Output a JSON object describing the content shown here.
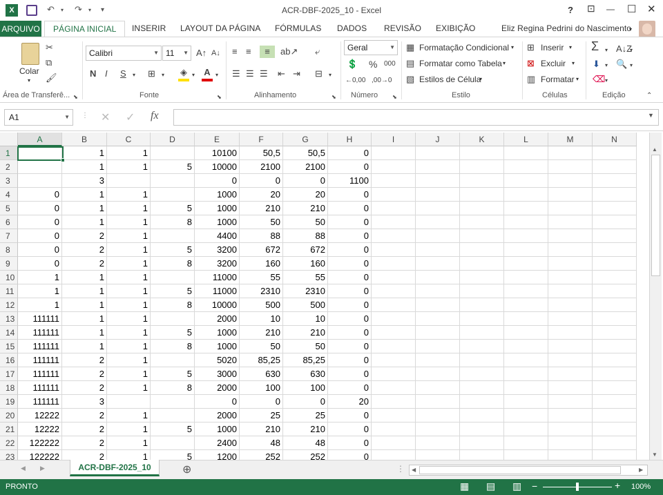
{
  "window": {
    "title": "ACR-DBF-2025_10 - Excel",
    "help_glyph": "?",
    "restore_ribbon_glyph": "⊡",
    "minimize_glyph": "—",
    "maximize_glyph": "☐",
    "close_glyph": "✕"
  },
  "quick_access": {
    "undo_glyph": "↶",
    "redo_glyph": "↷",
    "customize_glyph": "⩡"
  },
  "tabs": {
    "file": "ARQUIVO",
    "items": [
      "PÁGINA INICIAL",
      "INSERIR",
      "LAYOUT DA PÁGINA",
      "FÓRMULAS",
      "DADOS",
      "REVISÃO",
      "EXIBIÇÃO"
    ],
    "active": "PÁGINA INICIAL",
    "user": "Eliz Regina Pedrini do Nascimento"
  },
  "ribbon": {
    "clipboard": {
      "paste": "Colar",
      "label": "Área de Transferê..."
    },
    "font": {
      "name": "Calibri",
      "size": "11",
      "label": "Fonte",
      "bold": "N",
      "italic": "I",
      "underline": "S"
    },
    "alignment": {
      "label": "Alinhamento"
    },
    "number": {
      "format": "Geral",
      "label": "Número",
      "percent": "%",
      "thousands": "000"
    },
    "styles": {
      "conditional": "Formatação Condicional",
      "as_table": "Formatar como Tabela",
      "cell_styles": "Estilos de Célula",
      "label": "Estilo"
    },
    "cells": {
      "insert": "Inserir",
      "delete": "Excluir",
      "format": "Formatar",
      "label": "Células"
    },
    "editing": {
      "label": "Edição",
      "sum": "Σ"
    }
  },
  "formula_bar": {
    "name_box": "A1",
    "fx": "fx",
    "value": ""
  },
  "grid": {
    "columns": [
      "A",
      "B",
      "C",
      "D",
      "E",
      "F",
      "G",
      "H",
      "I",
      "J",
      "K",
      "L",
      "M",
      "N"
    ],
    "selected_column": "A",
    "selected_row": "1",
    "rows": [
      {
        "n": "1",
        "cells": [
          "",
          "1",
          "1",
          "",
          "10100",
          "50,5",
          "50,5",
          "0"
        ]
      },
      {
        "n": "2",
        "cells": [
          "",
          "1",
          "1",
          "5",
          "10000",
          "2100",
          "2100",
          "0"
        ]
      },
      {
        "n": "3",
        "cells": [
          "",
          "3",
          "",
          "",
          "0",
          "0",
          "0",
          "1100"
        ]
      },
      {
        "n": "4",
        "cells": [
          "0",
          "1",
          "1",
          "",
          "1000",
          "20",
          "20",
          "0"
        ]
      },
      {
        "n": "5",
        "cells": [
          "0",
          "1",
          "1",
          "5",
          "1000",
          "210",
          "210",
          "0"
        ]
      },
      {
        "n": "6",
        "cells": [
          "0",
          "1",
          "1",
          "8",
          "1000",
          "50",
          "50",
          "0"
        ]
      },
      {
        "n": "7",
        "cells": [
          "0",
          "2",
          "1",
          "",
          "4400",
          "88",
          "88",
          "0"
        ]
      },
      {
        "n": "8",
        "cells": [
          "0",
          "2",
          "1",
          "5",
          "3200",
          "672",
          "672",
          "0"
        ]
      },
      {
        "n": "9",
        "cells": [
          "0",
          "2",
          "1",
          "8",
          "3200",
          "160",
          "160",
          "0"
        ]
      },
      {
        "n": "10",
        "cells": [
          "1",
          "1",
          "1",
          "",
          "11000",
          "55",
          "55",
          "0"
        ]
      },
      {
        "n": "11",
        "cells": [
          "1",
          "1",
          "1",
          "5",
          "11000",
          "2310",
          "2310",
          "0"
        ]
      },
      {
        "n": "12",
        "cells": [
          "1",
          "1",
          "1",
          "8",
          "10000",
          "500",
          "500",
          "0"
        ]
      },
      {
        "n": "13",
        "cells": [
          "111111",
          "1",
          "1",
          "",
          "2000",
          "10",
          "10",
          "0"
        ]
      },
      {
        "n": "14",
        "cells": [
          "111111",
          "1",
          "1",
          "5",
          "1000",
          "210",
          "210",
          "0"
        ]
      },
      {
        "n": "15",
        "cells": [
          "111111",
          "1",
          "1",
          "8",
          "1000",
          "50",
          "50",
          "0"
        ]
      },
      {
        "n": "16",
        "cells": [
          "111111",
          "2",
          "1",
          "",
          "5020",
          "85,25",
          "85,25",
          "0"
        ]
      },
      {
        "n": "17",
        "cells": [
          "111111",
          "2",
          "1",
          "5",
          "3000",
          "630",
          "630",
          "0"
        ]
      },
      {
        "n": "18",
        "cells": [
          "111111",
          "2",
          "1",
          "8",
          "2000",
          "100",
          "100",
          "0"
        ]
      },
      {
        "n": "19",
        "cells": [
          "111111",
          "3",
          "",
          "",
          "0",
          "0",
          "0",
          "20"
        ]
      },
      {
        "n": "20",
        "cells": [
          "12222",
          "2",
          "1",
          "",
          "2000",
          "25",
          "25",
          "0"
        ]
      },
      {
        "n": "21",
        "cells": [
          "12222",
          "2",
          "1",
          "5",
          "1000",
          "210",
          "210",
          "0"
        ]
      },
      {
        "n": "22",
        "cells": [
          "122222",
          "2",
          "1",
          "",
          "2400",
          "48",
          "48",
          "0"
        ]
      },
      {
        "n": "23",
        "cells": [
          "122222",
          "2",
          "1",
          "5",
          "1200",
          "252",
          "252",
          "0"
        ]
      }
    ]
  },
  "sheets": {
    "active": "ACR-DBF-2025_10",
    "add_glyph": "⊕"
  },
  "status": {
    "mode": "PRONTO",
    "zoom": "100%",
    "zoom_level": 1.0
  },
  "colors": {
    "accent": "#217346",
    "selection": "#217346"
  }
}
